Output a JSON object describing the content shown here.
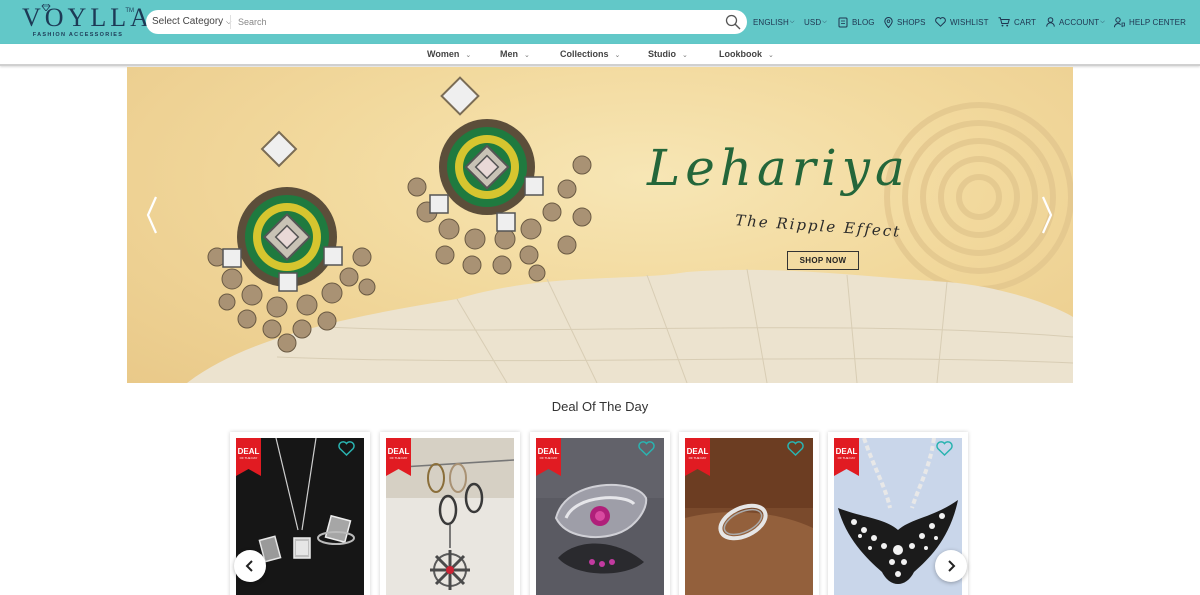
{
  "brand": {
    "name": "VOYLLA",
    "tm": "TM",
    "tagline": "FASHION ACCESSORIES"
  },
  "search": {
    "category_label": "Select Category",
    "placeholder": "Search"
  },
  "top_nav": {
    "language": "ENGLISH",
    "currency": "USD",
    "blog": "BLOG",
    "shops": "SHOPS",
    "wishlist": "WISHLIST",
    "cart": "CART",
    "account": "ACCOUNT",
    "help": "HELP CENTER"
  },
  "category_nav": [
    "Women",
    "Men",
    "Collections",
    "Studio",
    "Lookbook"
  ],
  "hero": {
    "title": "Lehariya",
    "subtitle": "The Ripple Effect",
    "cta": "SHOP NOW"
  },
  "deals": {
    "heading": "Deal Of The Day",
    "badge_label": "DEAL",
    "badge_sub": "OF THE DAY",
    "products": [
      {
        "kind": "pendant-and-ring-set"
      },
      {
        "kind": "chain-necklace"
      },
      {
        "kind": "silver-ring-stone"
      },
      {
        "kind": "silver-band-ring"
      },
      {
        "kind": "bird-pearl-necklace"
      }
    ]
  },
  "colors": {
    "header": "#62c8c8",
    "brand_navy": "#1d3a56",
    "hero_green": "#24663a",
    "deal_red": "#e11b22",
    "heart_teal": "#2ab3b0"
  },
  "icons": [
    "search-icon",
    "blog-icon",
    "map-pin-icon",
    "heart-icon",
    "cart-icon",
    "user-icon",
    "help-icon",
    "chevron-left-icon",
    "chevron-right-icon"
  ]
}
